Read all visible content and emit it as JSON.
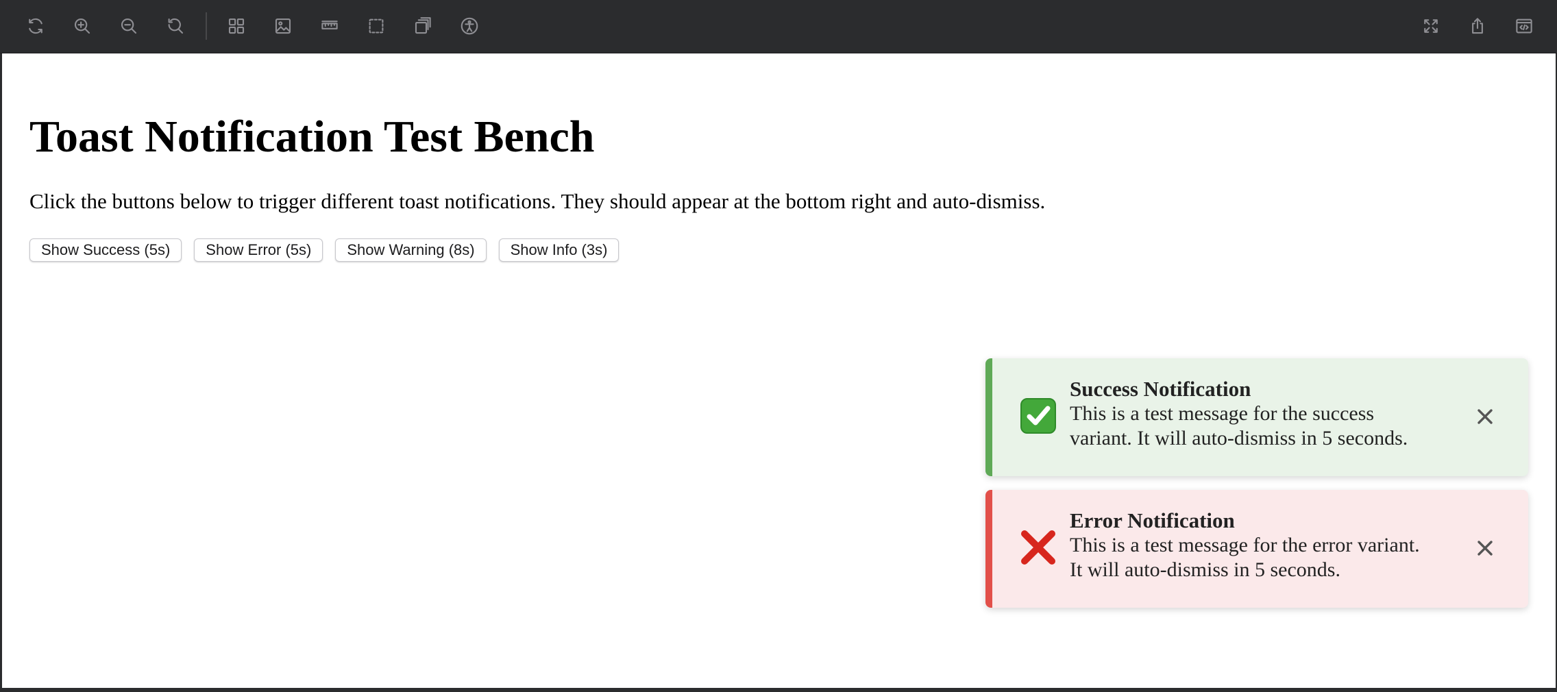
{
  "toolbar": {
    "left_icons": [
      "refresh-icon",
      "zoom-in-icon",
      "zoom-out-icon",
      "reset-zoom-icon",
      "grid-icon",
      "image-icon",
      "ruler-icon",
      "selection-icon",
      "layers-icon",
      "accessibility-icon"
    ],
    "right_icons": [
      "fullscreen-icon",
      "share-icon",
      "code-view-icon"
    ]
  },
  "page": {
    "title": "Toast Notification Test Bench",
    "description": "Click the buttons below to trigger different toast notifications. They should appear at the bottom right and auto-dismiss."
  },
  "buttons": {
    "success": "Show Success (5s)",
    "error": "Show Error (5s)",
    "warning": "Show Warning (8s)",
    "info": "Show Info (3s)"
  },
  "toasts": [
    {
      "variant": "success",
      "icon": "check-icon",
      "title": "Success Notification",
      "message_line1": "This is a test message for the success",
      "message_line2": "variant. It will auto-dismiss in 5 seconds.",
      "accent": "#5fa957",
      "background": "#e9f3e8"
    },
    {
      "variant": "error",
      "icon": "cross-icon",
      "title": "Error Notification",
      "message_line1": "This is a test message for the error variant.",
      "message_line2": "It will auto-dismiss in 5 seconds.",
      "accent": "#e2504a",
      "background": "#fbe9ea"
    }
  ]
}
